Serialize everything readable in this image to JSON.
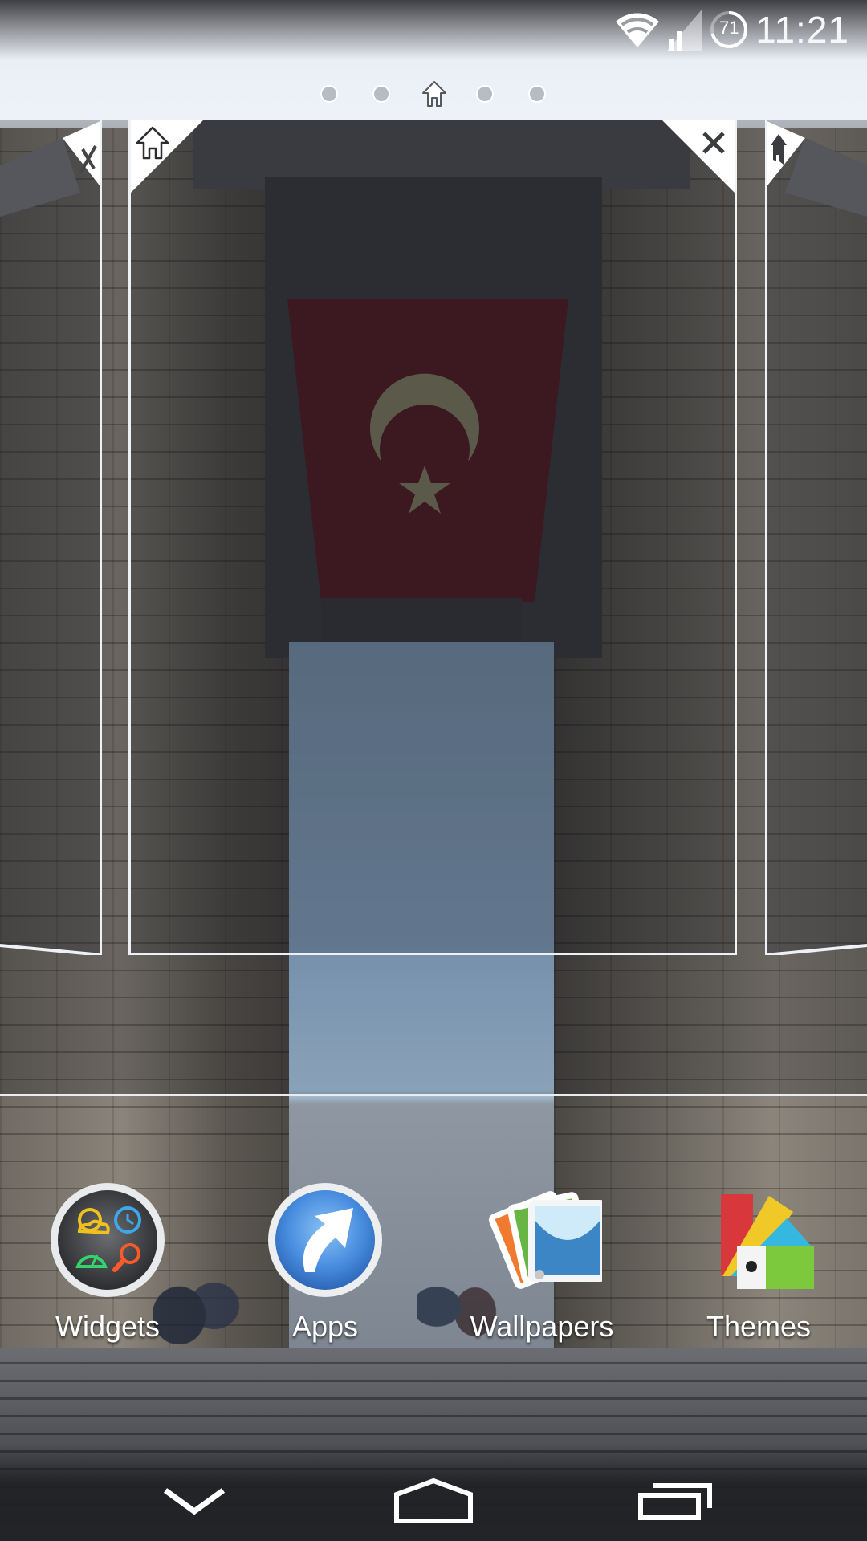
{
  "status_bar": {
    "time": "11:21",
    "battery_level": "71",
    "wifi": "wifi-icon",
    "signal": "cell-signal-icon"
  },
  "pager": {
    "pages": 5,
    "current_page": 3,
    "home_page": 3
  },
  "panels": {
    "center": {
      "home_icon": "home-icon",
      "close_icon": "close-icon"
    },
    "left": {
      "close_icon": "close-icon"
    },
    "right": {
      "home_icon": "home-icon"
    }
  },
  "dock": {
    "items": [
      {
        "label": "Widgets",
        "icon": "widgets-icon"
      },
      {
        "label": "Apps",
        "icon": "apps-icon"
      },
      {
        "label": "Wallpapers",
        "icon": "wallpapers-icon"
      },
      {
        "label": "Themes",
        "icon": "themes-icon"
      }
    ]
  },
  "navbar": {
    "back": "back-chevron-icon",
    "home": "home-icon",
    "recents": "recents-icon"
  },
  "colors": {
    "flag_red": "#5a1a22",
    "apps_blue": "#4a8fe0",
    "panel_border": "#eef1f5"
  }
}
